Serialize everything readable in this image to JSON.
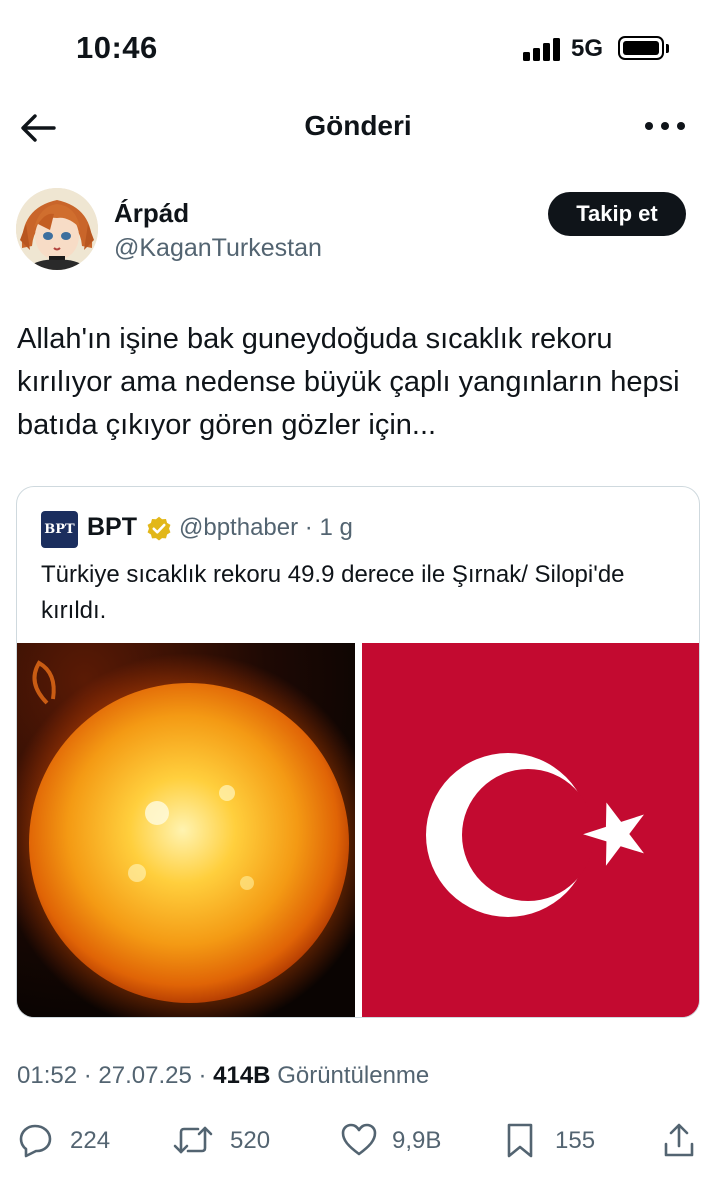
{
  "status_bar": {
    "time": "10:46",
    "network": "5G",
    "signal_bars": 4,
    "battery_level": 1.0
  },
  "header": {
    "title": "Gönderi",
    "back_icon": "arrow-left-icon",
    "more_icon": "more-horizontal-icon"
  },
  "author": {
    "name": "Árpád",
    "handle": "@KaganTurkestan",
    "follow_label": "Takip et",
    "avatar_icon": "anime-avatar"
  },
  "tweet": {
    "text": "Allah'ın işine bak guneydoğuda sıcaklık rekoru kırılıyor ama nedense büyük çaplı yangınların hepsi batıda çıkıyor gören gözler için..."
  },
  "quote": {
    "logo_text": "BPT",
    "name": "BPT",
    "handle_time": "@bpthaber · 1 g",
    "verified_color": "#e2b719",
    "text": "Türkiye sıcaklık rekoru 49.9 derece ile Şırnak/ Silopi'de kırıldı.",
    "media": [
      "sun-image",
      "turkish-flag-image"
    ]
  },
  "meta": {
    "time_date": "01:52 · 27.07.25 · ",
    "views_count": "414B",
    "views_label": "Görüntülenme"
  },
  "actions": {
    "reply_count": "224",
    "retweet_count": "520",
    "like_count": "9,9B",
    "bookmark_count": "155"
  },
  "colors": {
    "text_primary": "#0f1419",
    "text_secondary": "#536471",
    "border": "#cfd9de",
    "flag_red": "#c30a30"
  }
}
